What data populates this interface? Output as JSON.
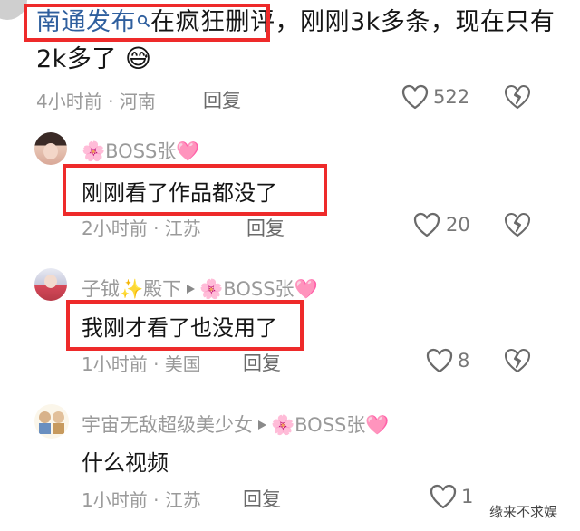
{
  "comment1": {
    "topic": "南通发布",
    "text_after_topic": "在疯狂删评，刚刚3k多条，现在只有",
    "text_line2": "2k多了",
    "emoji": "😅",
    "time_location": "4小时前 · 河南",
    "reply_label": "回复",
    "like_count": "522"
  },
  "reply1": {
    "username": "🌸BOSS张🩷",
    "text": "刚刚看了作品都没了",
    "time_location": "2小时前 · 江苏",
    "reply_label": "回复",
    "like_count": "20"
  },
  "reply2": {
    "username": "子钺✨殿下",
    "reply_to": "🌸BOSS张🩷",
    "text": "我刚才看了也没用了",
    "time_location": "1小时前 · 美国",
    "reply_label": "回复",
    "like_count": "8"
  },
  "reply3": {
    "username": "宇宙无敌超级美少女",
    "reply_to": "🌸BOSS张🩷",
    "text": "什么视频",
    "time_location": "1小时前 · 江苏",
    "reply_label": "回复",
    "like_count": "1"
  },
  "watermark": "缘来不求娱",
  "icons": {
    "like": "heart-outline-icon",
    "dislike": "broken-heart-icon",
    "search": "search-icon",
    "arrow": "play-arrow-icon"
  },
  "colors": {
    "topic_link": "#2f5f9e",
    "highlight_box": "#ee2a2a",
    "meta_text": "#9a9a9a"
  }
}
